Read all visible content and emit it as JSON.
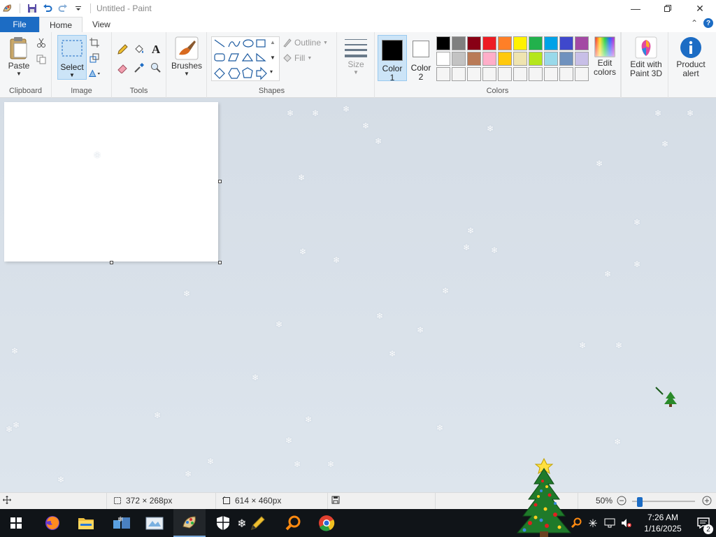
{
  "window": {
    "title": "Untitled - Paint",
    "controls": [
      "minimize",
      "restore",
      "close"
    ]
  },
  "quick_access": {
    "icons": [
      "paint-app-icon",
      "save-icon",
      "undo-icon",
      "redo-icon",
      "customize-qat-icon"
    ]
  },
  "tabs": {
    "file": "File",
    "home": "Home",
    "view": "View"
  },
  "ribbon": {
    "clipboard": {
      "paste": "Paste",
      "group": "Clipboard"
    },
    "image": {
      "select": "Select",
      "group": "Image"
    },
    "tools": {
      "group": "Tools"
    },
    "brushes": {
      "label": "Brushes"
    },
    "shapes": {
      "outline": "Outline",
      "fill": "Fill",
      "group": "Shapes"
    },
    "size": {
      "label": "Size"
    },
    "colors": {
      "color1": "Color",
      "color1_num": "1",
      "color2": "Color",
      "color2_num": "2",
      "edit_colors": "Edit",
      "edit_colors_2": "colors",
      "group": "Colors",
      "color1_value": "#000000",
      "color2_value": "#ffffff",
      "palette": [
        "#000000",
        "#7f7f7f",
        "#880015",
        "#ed1c24",
        "#ff7f27",
        "#fff200",
        "#22b14c",
        "#00a2e8",
        "#3f48cc",
        "#a349a4",
        "#ffffff",
        "#c3c3c3",
        "#b97a57",
        "#ffaec9",
        "#ffc90e",
        "#efe4b0",
        "#b5e61d",
        "#99d9ea",
        "#7092be",
        "#c8bfe7",
        "#f5f5f5",
        "#f5f5f5",
        "#f5f5f5",
        "#f5f5f5",
        "#f5f5f5",
        "#f5f5f5",
        "#f5f5f5",
        "#f5f5f5",
        "#f5f5f5",
        "#f5f5f5"
      ]
    },
    "paint3d": {
      "line1": "Edit with",
      "line2": "Paint 3D"
    },
    "product_alert": {
      "line1": "Product",
      "line2": "alert"
    }
  },
  "statusbar": {
    "selection_size": "372 × 268px",
    "canvas_size": "614 × 460px",
    "zoom": "50%",
    "zoom_level": 0.5
  },
  "taskbar": {
    "apps": [
      "start-icon",
      "firefox-icon",
      "file-explorer-icon",
      "snow-app-icon",
      "paint-classic-icon",
      "paint-icon",
      "security-icon",
      "snowflake-icon",
      "pencil-app-icon",
      "search-app-icon",
      "chrome-icon"
    ],
    "time": "7:26 AM",
    "date": "1/16/2025",
    "notifications": "2"
  }
}
